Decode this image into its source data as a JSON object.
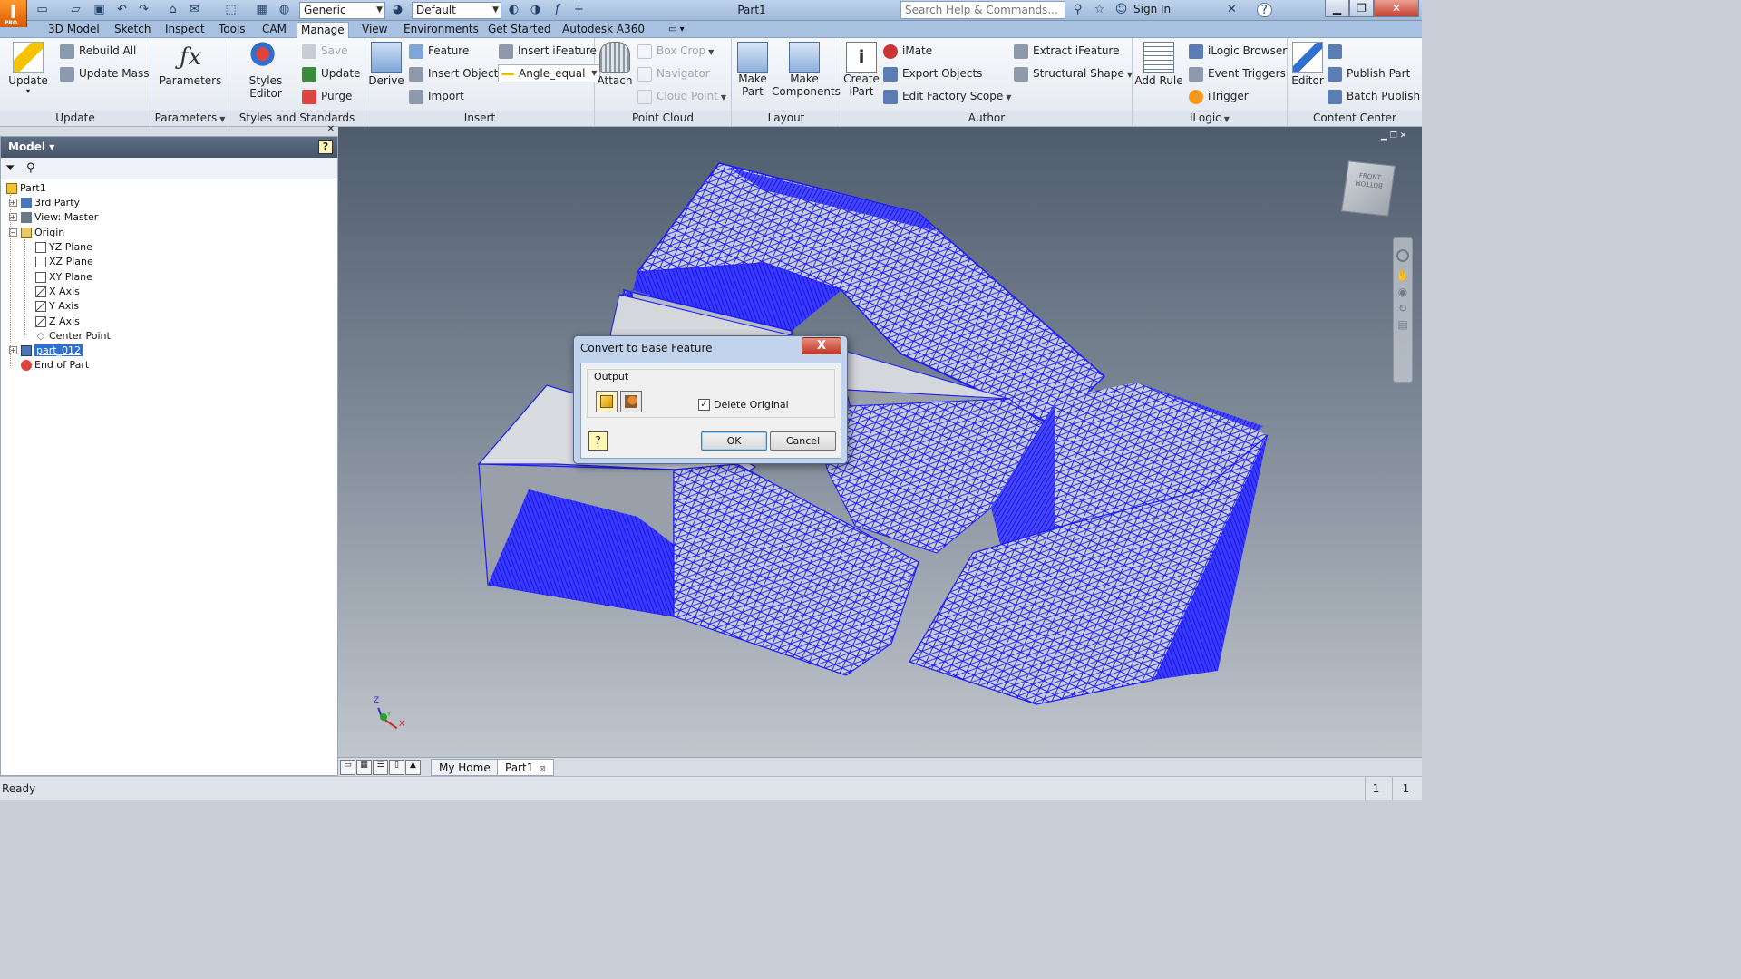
{
  "titlebar": {
    "app_logo": "I",
    "app_logo_sub": "PRO",
    "material_combo": "Generic",
    "appearance_combo": "Default",
    "document_title": "Part1",
    "search_placeholder": "Search Help & Commands...",
    "sign_in": "Sign In",
    "help": "?"
  },
  "menu_tabs": [
    "3D Model",
    "Sketch",
    "Inspect",
    "Tools",
    "CAM",
    "Manage",
    "View",
    "Environments",
    "Get Started",
    "Autodesk A360"
  ],
  "active_tab": "Manage",
  "ribbon": {
    "update": {
      "update": "Update",
      "rebuild_all": "Rebuild All",
      "update_mass": "Update Mass",
      "group": "Update"
    },
    "parameters": {
      "parameters": "Parameters",
      "group": "Parameters"
    },
    "styles": {
      "styles_editor": "Styles Editor",
      "save": "Save",
      "update": "Update",
      "purge": "Purge",
      "group": "Styles and Standards"
    },
    "insert": {
      "derive": "Derive",
      "feature": "Feature",
      "insert_object": "Insert Object",
      "import": "Import",
      "insert_ifeature": "Insert iFeature",
      "angle_combo": "Angle_equal",
      "group": "Insert"
    },
    "point_cloud": {
      "attach": "Attach",
      "box_crop": "Box Crop",
      "navigator": "Navigator",
      "cloud_point": "Cloud Point",
      "group": "Point Cloud"
    },
    "layout": {
      "make_part_1": "Make",
      "make_part_2": "Part",
      "make_components_1": "Make",
      "make_components_2": "Components",
      "group": "Layout"
    },
    "author": {
      "create_ipart_1": "Create",
      "create_ipart_2": "iPart",
      "imate": "iMate",
      "export_objects": "Export Objects",
      "edit_factory_scope": "Edit Factory Scope",
      "extract_ifeature": "Extract iFeature",
      "structural_shape": "Structural Shape",
      "group": "Author"
    },
    "ilogic": {
      "add_rule": "Add Rule",
      "ilogic_browser": "iLogic Browser",
      "event_triggers": "Event Triggers",
      "itrigger": "iTrigger",
      "group": "iLogic"
    },
    "content_center": {
      "editor": "Editor",
      "publish_part": "Publish Part",
      "batch_publish": "Batch Publish",
      "group": "Content Center"
    }
  },
  "browser": {
    "title": "Model",
    "tree": [
      {
        "label": "Part1",
        "level": 0
      },
      {
        "label": "3rd Party",
        "level": 1
      },
      {
        "label": "View: Master",
        "level": 1
      },
      {
        "label": "Origin",
        "level": 1
      },
      {
        "label": "YZ Plane",
        "level": 2
      },
      {
        "label": "XZ Plane",
        "level": 2
      },
      {
        "label": "XY Plane",
        "level": 2
      },
      {
        "label": "X Axis",
        "level": 2
      },
      {
        "label": "Y Axis",
        "level": 2
      },
      {
        "label": "Z Axis",
        "level": 2
      },
      {
        "label": "Center Point",
        "level": 2
      },
      {
        "label": "part_012",
        "level": 1,
        "selected": true
      },
      {
        "label": "End of Part",
        "level": 1
      }
    ]
  },
  "dialog": {
    "title": "Convert to Base Feature",
    "close": "X",
    "output_label": "Output",
    "delete_original": "Delete Original",
    "delete_original_checked": true,
    "ok": "OK",
    "cancel": "Cancel",
    "help": "?"
  },
  "viewcube": {
    "front": "FRONT",
    "bottom": "BOTTOM"
  },
  "axes": {
    "x": "X",
    "y": "Y",
    "z": "Z"
  },
  "doc_tabs": [
    "My Home",
    "Part1"
  ],
  "status": {
    "text": "Ready",
    "count1": "1",
    "count2": "1"
  },
  "colors": {
    "mesh": "#1a1aff",
    "accent": "#2f6fd0",
    "ribbon_bg": "#eef1f5",
    "titlebar": "#b2c7e4"
  }
}
